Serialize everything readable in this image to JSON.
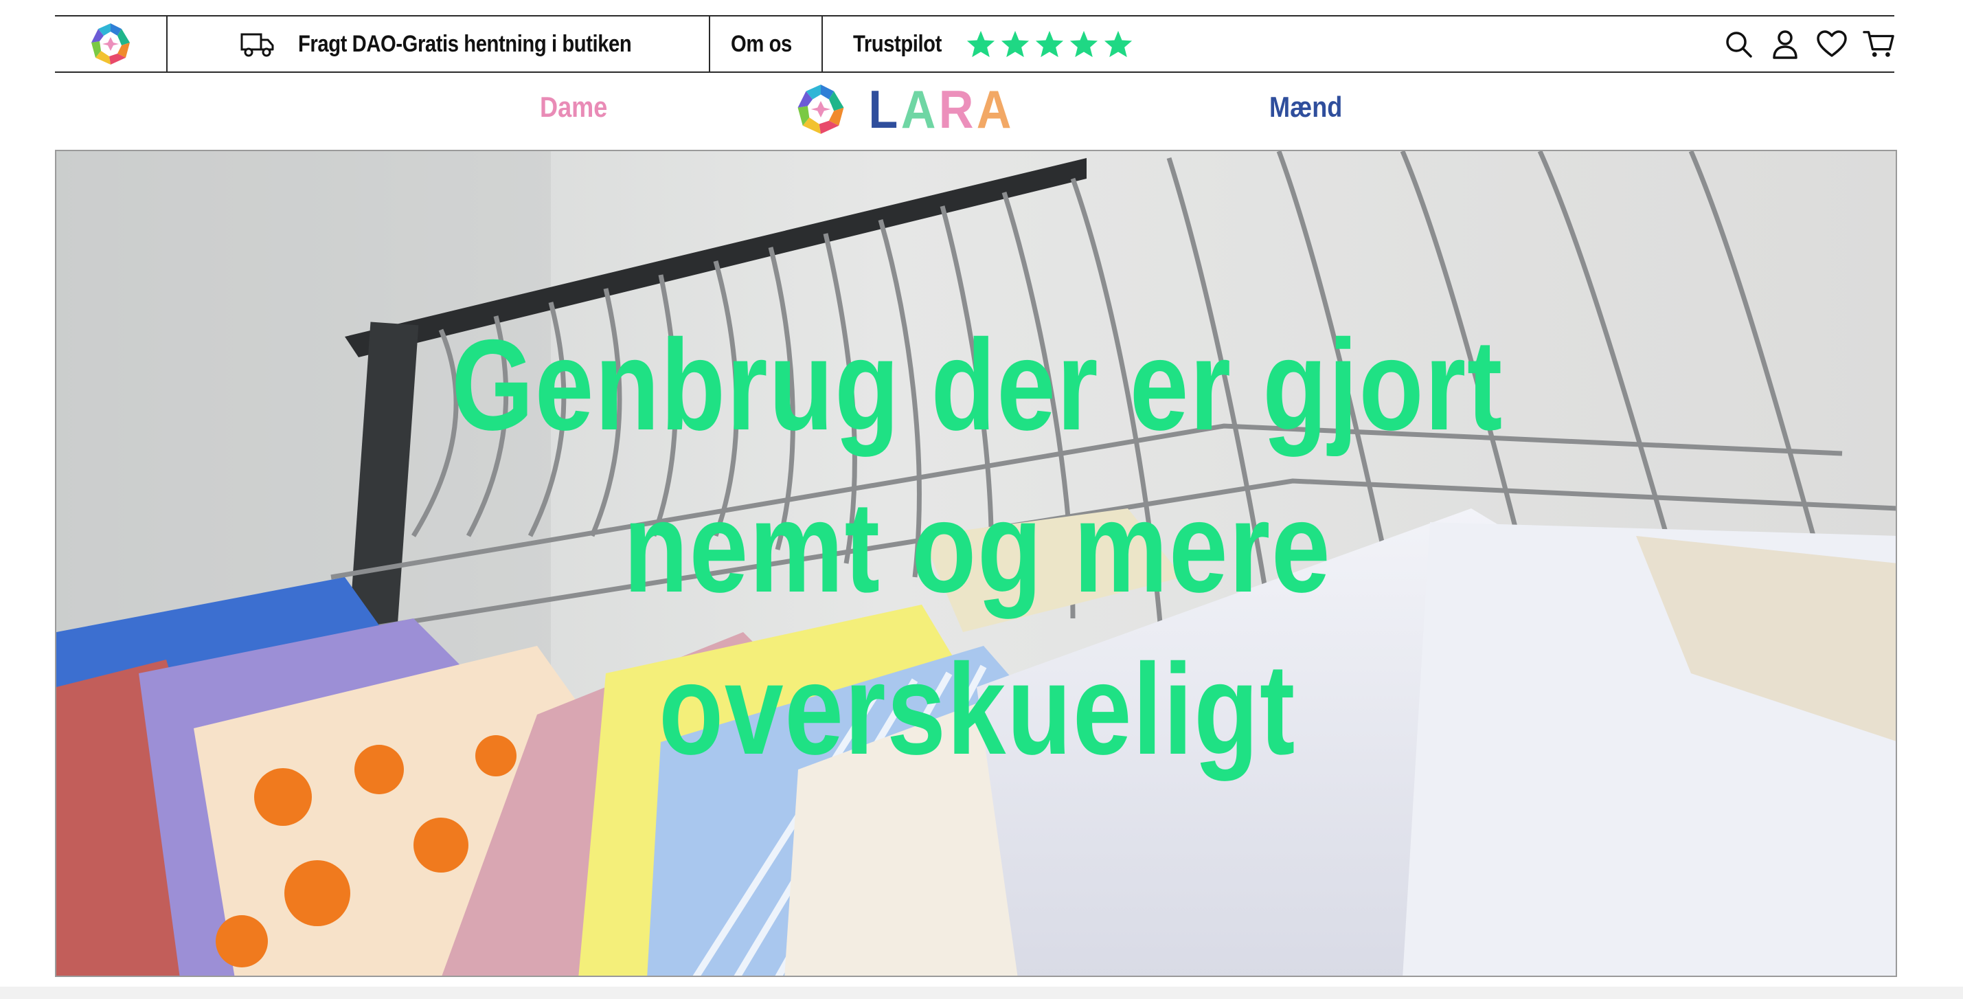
{
  "announcement": {
    "shipping_text": "Fragt DAO-Gratis hentning i butiken",
    "about_label": "Om os",
    "trustpilot_label": "Trustpilot",
    "trustpilot_rating": 5,
    "star_color": "#1fd884"
  },
  "header_icons": [
    "search-icon",
    "account-icon",
    "heart-icon",
    "cart-icon"
  ],
  "nav": {
    "women_label": "Dame",
    "men_label": "Mænd",
    "brand": {
      "letters": [
        "L",
        "A",
        "R",
        "A"
      ],
      "letter_colors": [
        "#2f4e9c",
        "#6fd6a4",
        "#ec8fbb",
        "#f2a865"
      ]
    }
  },
  "hero": {
    "headline_lines": [
      "Genbrug der er gjort",
      "nemt og mere",
      "overskueligt"
    ],
    "headline_color": "#1fe184",
    "image_description_icon": "clothes-rack-photo"
  }
}
